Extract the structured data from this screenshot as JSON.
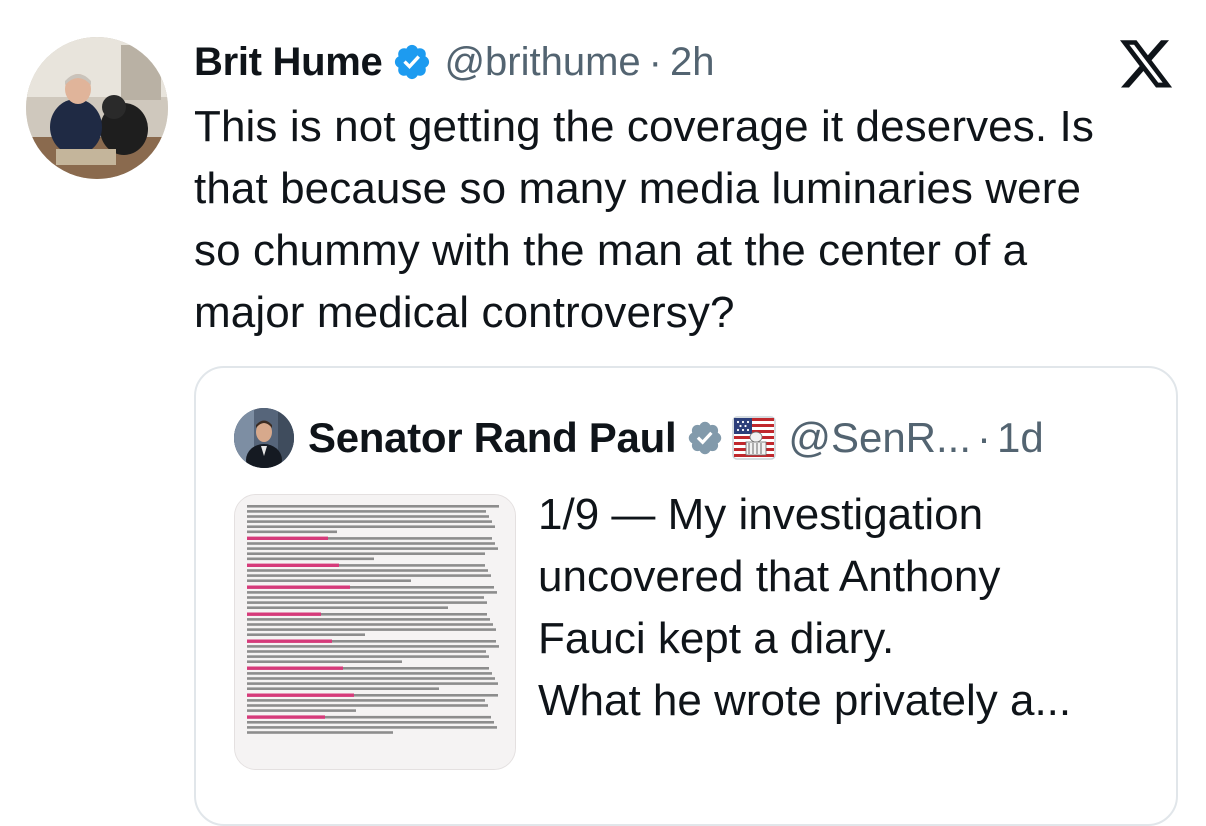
{
  "author": {
    "name": "Brit Hume",
    "handle": "@brithume",
    "separator": "·",
    "time": "2h",
    "verified_icon": "verified-badge-icon"
  },
  "tweet_text": "This is not getting the coverage it deserves. Is\nthat because so many media luminaries were\nso chummy with the man at the center of a\nmajor medical controversy?",
  "x_logo": "x-logo-icon",
  "quoted": {
    "name": "Senator Rand Paul",
    "handle": "@SenR...",
    "separator": "·",
    "time": "1d",
    "verified_icon": "verified-badge-icon",
    "affiliation_icon": "us-government-badge-icon",
    "text": "1/9 — My investigation\nuncovered that Anthony\nFauci kept a diary.\nWhat he wrote privately a..."
  },
  "colors": {
    "verified": "#1d9bf0",
    "handle": "#536471",
    "text": "#0f1419",
    "quote_border": "#e1e6ea",
    "document_heading": "#d63a7a"
  }
}
